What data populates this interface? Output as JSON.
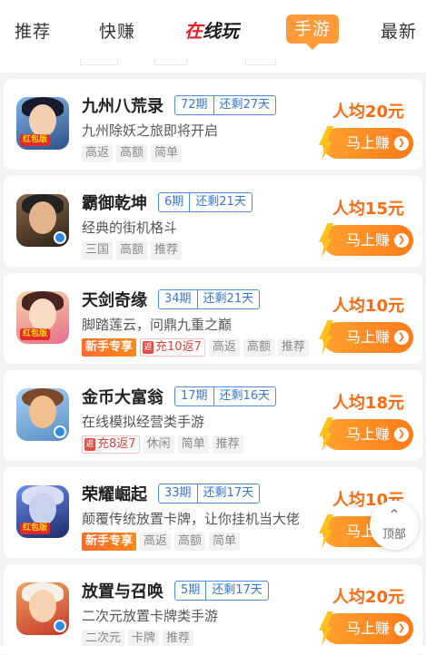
{
  "tabs": [
    {
      "label": "推荐",
      "active": false
    },
    {
      "label": "快赚",
      "active": false
    },
    {
      "label_a": "在",
      "label_b": "线玩",
      "active": false
    },
    {
      "label": "手游",
      "active": true
    },
    {
      "label": "最新",
      "active": false
    }
  ],
  "games": [
    {
      "name": "九州八荒录",
      "period": "72期",
      "remaining": "还剩27天",
      "desc": "九州除妖之旅即将开启",
      "tags": [
        "高返",
        "高额",
        "简单"
      ],
      "new_badge": "",
      "recharge": "",
      "price": "人均20元",
      "button": "马上赚",
      "icon_badge": "红包版",
      "icon": "game-icon-jiuzhou"
    },
    {
      "name": "霸御乾坤",
      "period": "6期",
      "remaining": "还剩21天",
      "desc": "经典的街机格斗",
      "tags": [
        "三国",
        "高额",
        "推荐"
      ],
      "new_badge": "",
      "recharge": "",
      "price": "人均15元",
      "button": "马上赚",
      "icon_badge": "",
      "icon": "game-icon-bayu"
    },
    {
      "name": "天剑奇缘",
      "period": "34期",
      "remaining": "还剩21天",
      "desc": "脚踏莲云，问鼎九重之巅",
      "tags": [
        "高返",
        "高额",
        "推荐"
      ],
      "new_badge": "新手专享",
      "recharge": "充10返7",
      "price": "人均10元",
      "button": "马上赚",
      "icon_badge": "红包版",
      "icon": "game-icon-tianjian"
    },
    {
      "name": "金币大富翁",
      "period": "17期",
      "remaining": "还剩16天",
      "desc": "在线模拟经营类手游",
      "tags": [
        "休闲",
        "简单",
        "推荐"
      ],
      "new_badge": "",
      "recharge": "充8返7",
      "price": "人均18元",
      "button": "马上赚",
      "icon_badge": "",
      "icon": "game-icon-jinbi"
    },
    {
      "name": "荣耀崛起",
      "period": "33期",
      "remaining": "还剩17天",
      "desc": "颠覆传统放置卡牌，让你挂机当大佬",
      "tags": [
        "高返",
        "高额",
        "简单"
      ],
      "new_badge": "新手专享",
      "recharge": "",
      "price": "人均10元",
      "button": "马上赚",
      "icon_badge": "红包版",
      "icon": "game-icon-rongyao"
    },
    {
      "name": "放置与召唤",
      "period": "5期",
      "remaining": "还剩17天",
      "desc": "二次元放置卡牌类手游",
      "tags": [
        "二次元",
        "卡牌",
        "推荐"
      ],
      "new_badge": "",
      "recharge": "",
      "price": "人均20元",
      "button": "马上赚",
      "icon_badge": "",
      "icon": "game-icon-fangzhi"
    }
  ],
  "back_to_top": {
    "label": "顶部"
  },
  "colors": {
    "accent": "#ff9a3c",
    "price": "#ff6a10",
    "period_border": "#4a90e2"
  }
}
